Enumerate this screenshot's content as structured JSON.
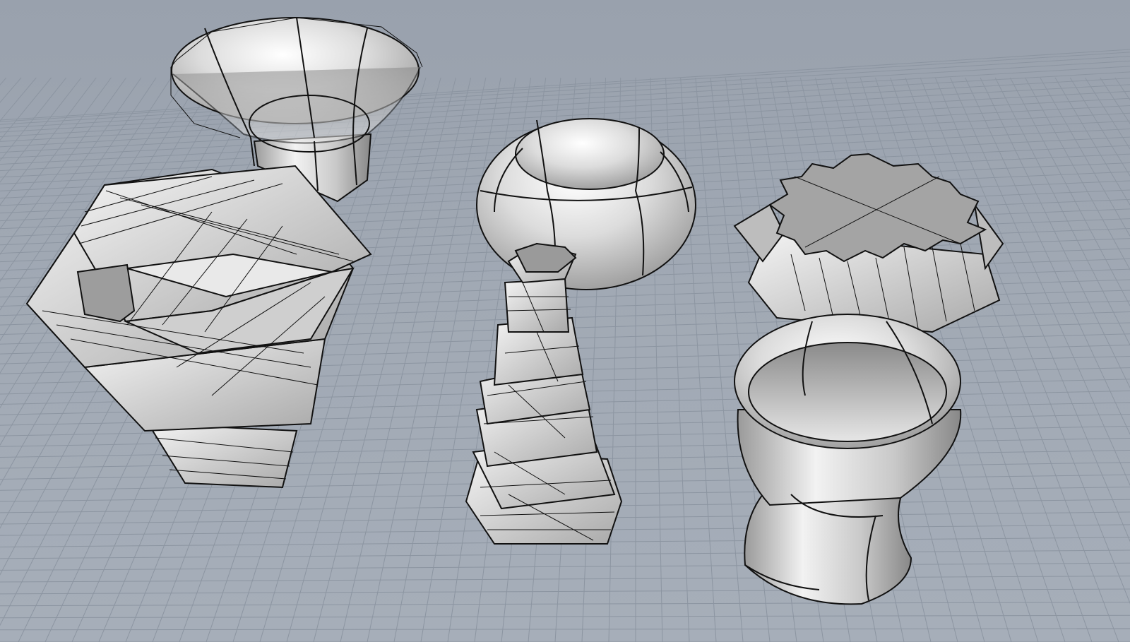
{
  "viewport": {
    "label": "",
    "display_mode": "shaded",
    "grid": "on",
    "background_color": "#9ea6b1",
    "grid_color": "#8c95a1",
    "surface_color": "#d6d6d6",
    "isocurve_color": "#111111"
  },
  "objects": [
    {
      "id": "flared-vase",
      "type": "revolved-surface"
    },
    {
      "id": "twisted-polygon-vase-large",
      "type": "twisted-extrusion"
    },
    {
      "id": "squat-pot",
      "type": "revolved-surface"
    },
    {
      "id": "twisted-polygon-vase-tall",
      "type": "twisted-extrusion"
    },
    {
      "id": "star-prism",
      "type": "star-extrusion"
    },
    {
      "id": "bulb-vase",
      "type": "revolved-surface"
    }
  ]
}
